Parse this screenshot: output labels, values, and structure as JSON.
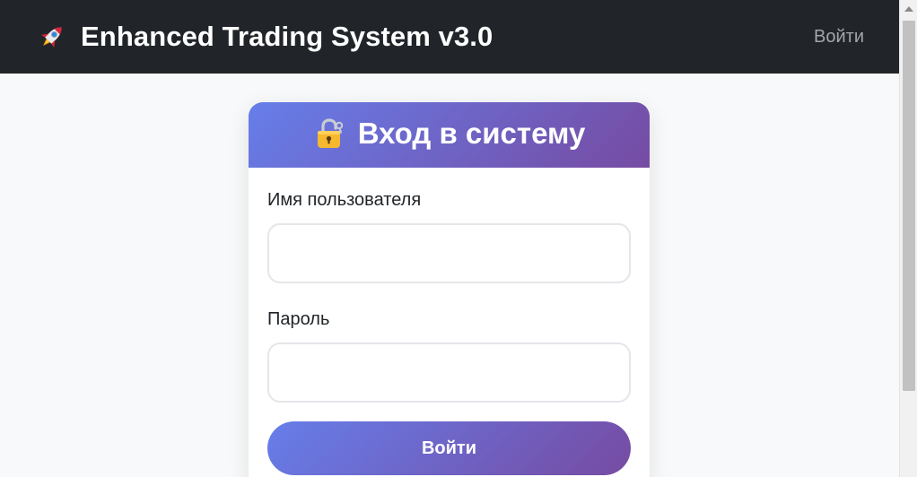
{
  "navbar": {
    "brand_icon": "rocket-icon",
    "brand_title": "Enhanced Trading System v3.0",
    "login_link": "Войти"
  },
  "login_card": {
    "header_icon": "lock-icon",
    "title": "Вход в систему",
    "username_label": "Имя пользователя",
    "username_value": "",
    "password_label": "Пароль",
    "password_value": "",
    "submit_label": "Войти"
  },
  "colors": {
    "navbar_bg": "#212529",
    "page_bg": "#f8f9fa",
    "gradient_start": "#667eea",
    "gradient_end": "#764ba2",
    "nav_link": "#a3a6a9"
  }
}
